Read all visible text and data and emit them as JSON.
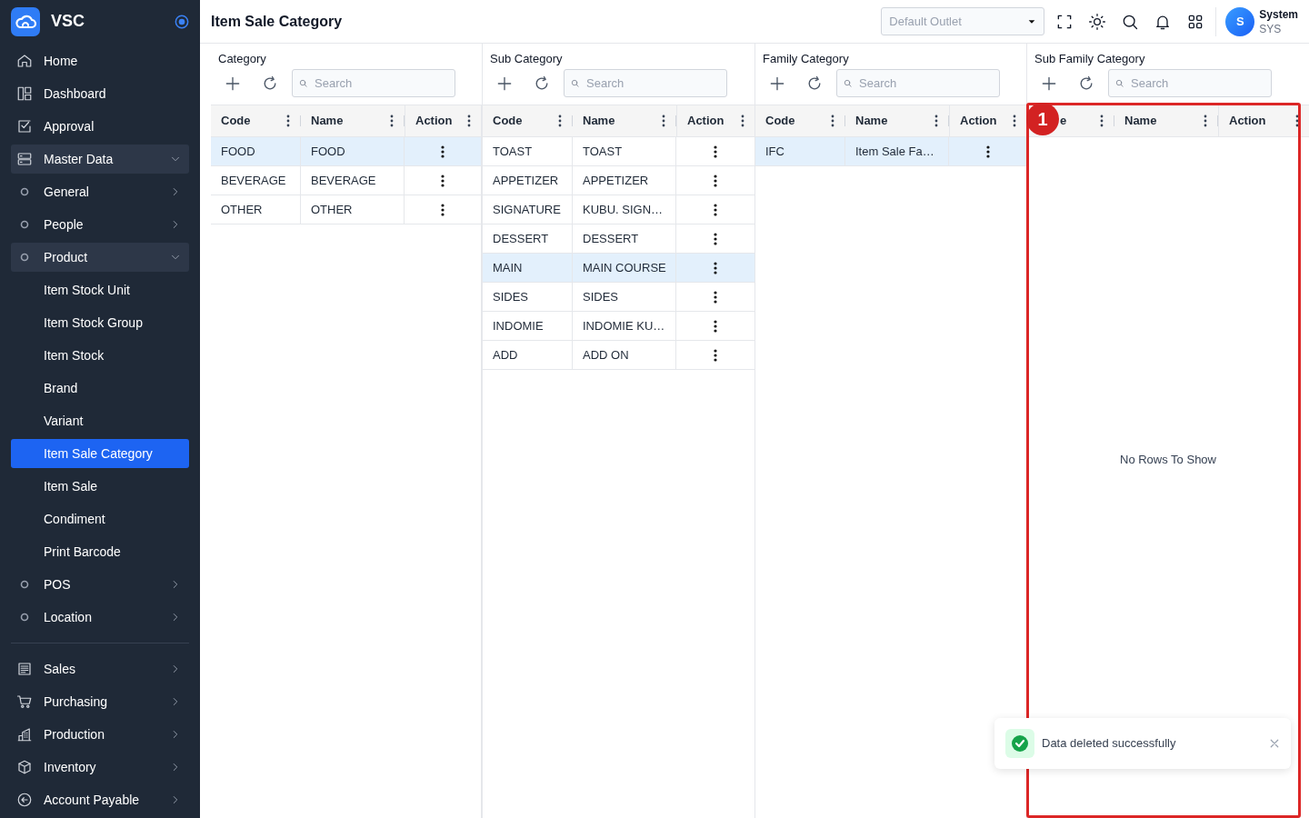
{
  "sidebar": {
    "app_name": "VSC",
    "sections": [
      {
        "items": [
          {
            "label": "Home",
            "selected": false
          },
          {
            "label": "Dashboard",
            "selected": false
          },
          {
            "label": "Approval",
            "selected": false
          },
          {
            "label": "Master Data",
            "selected": false,
            "expanded": true,
            "children": [
              {
                "label": "General",
                "selected": false,
                "expanded": false
              },
              {
                "label": "People",
                "selected": false,
                "expanded": false
              },
              {
                "label": "Product",
                "selected": false,
                "expanded": true,
                "children": [
                  {
                    "label": "Item Stock Unit",
                    "selected": false
                  },
                  {
                    "label": "Item Stock Group",
                    "selected": false
                  },
                  {
                    "label": "Item Stock",
                    "selected": false
                  },
                  {
                    "label": "Brand",
                    "selected": false
                  },
                  {
                    "label": "Variant",
                    "selected": false
                  },
                  {
                    "label": "Item Sale Category",
                    "selected": true
                  },
                  {
                    "label": "Item Sale",
                    "selected": false
                  },
                  {
                    "label": "Condiment",
                    "selected": false
                  },
                  {
                    "label": "Print Barcode",
                    "selected": false
                  }
                ]
              },
              {
                "label": "POS",
                "selected": false,
                "expanded": false
              },
              {
                "label": "Location",
                "selected": false,
                "expanded": false
              }
            ]
          }
        ]
      },
      {
        "items": [
          {
            "label": "Sales",
            "selected": false,
            "expanded": false
          },
          {
            "label": "Purchasing",
            "selected": false,
            "expanded": false
          },
          {
            "label": "Production",
            "selected": false,
            "expanded": false
          },
          {
            "label": "Inventory",
            "selected": false,
            "expanded": false
          },
          {
            "label": "Account Payable",
            "selected": false,
            "expanded": false
          }
        ]
      }
    ]
  },
  "header": {
    "title": "Item Sale Category",
    "outlet_select": {
      "placeholder": "Default Outlet"
    },
    "user": {
      "avatar": "S",
      "name": "System",
      "role": "SYS"
    }
  },
  "panels": [
    {
      "title": "Category",
      "search": {
        "placeholder": "Search"
      },
      "columns": [
        "Code",
        "Name",
        "Action"
      ],
      "rows": [
        {
          "code": "FOOD",
          "name": "FOOD",
          "selected": true
        },
        {
          "code": "BEVERAGE",
          "name": "BEVERAGE",
          "selected": false
        },
        {
          "code": "OTHER",
          "name": "OTHER",
          "selected": false
        }
      ]
    },
    {
      "title": "Sub Category",
      "search": {
        "placeholder": "Search"
      },
      "columns": [
        "Code",
        "Name",
        "Action"
      ],
      "rows": [
        {
          "code": "TOAST",
          "name": "TOAST",
          "selected": false
        },
        {
          "code": "APPETIZER",
          "name": "APPETIZER",
          "selected": false
        },
        {
          "code": "SIGNATURE",
          "name": "KUBU. SIGN…",
          "selected": false
        },
        {
          "code": "DESSERT",
          "name": "DESSERT",
          "selected": false
        },
        {
          "code": "MAIN",
          "name": "MAIN COURSE",
          "selected": true
        },
        {
          "code": "SIDES",
          "name": "SIDES",
          "selected": false
        },
        {
          "code": "INDOMIE",
          "name": "INDOMIE KU…",
          "selected": false
        },
        {
          "code": "ADD",
          "name": "ADD ON",
          "selected": false
        }
      ]
    },
    {
      "title": "Family Category",
      "search": {
        "placeholder": "Search"
      },
      "columns": [
        "Code",
        "Name",
        "Action"
      ],
      "rows": [
        {
          "code": "IFC",
          "name": "Item Sale Fa…",
          "selected": true
        }
      ]
    },
    {
      "title": "Sub Family Category",
      "search": {
        "placeholder": "Search"
      },
      "columns": [
        "e",
        "Name",
        "Action"
      ],
      "empty_message": "No Rows To Show"
    }
  ],
  "toast": {
    "message": "Data deleted successfully"
  },
  "annotation": {
    "label": "1"
  }
}
